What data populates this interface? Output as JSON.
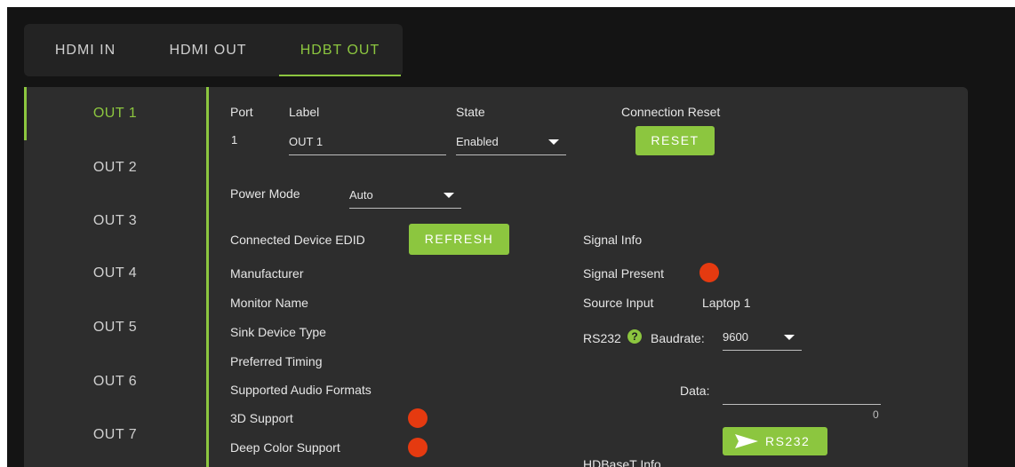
{
  "tabs": [
    {
      "label": "HDMI IN"
    },
    {
      "label": "HDMI OUT"
    },
    {
      "label": "HDBT OUT"
    }
  ],
  "active_tab": "HDBT OUT",
  "sidebar": {
    "items": [
      {
        "label": "OUT 1"
      },
      {
        "label": "OUT 2"
      },
      {
        "label": "OUT 3"
      },
      {
        "label": "OUT 4"
      },
      {
        "label": "OUT 5"
      },
      {
        "label": "OUT 6"
      },
      {
        "label": "OUT 7"
      }
    ],
    "selected": "OUT 1"
  },
  "port": {
    "header_port": "Port",
    "header_label": "Label",
    "header_state": "State",
    "header_reset": "Connection Reset",
    "number": "1",
    "label_value": "OUT 1",
    "state_value": "Enabled",
    "reset_label": "RESET"
  },
  "power": {
    "label": "Power Mode",
    "value": "Auto"
  },
  "edid": {
    "title": "Connected Device EDID",
    "refresh_label": "REFRESH",
    "manufacturer": "Manufacturer",
    "monitor_name": "Monitor Name",
    "sink_device_type": "Sink Device Type",
    "preferred_timing": "Preferred Timing",
    "supported_audio": "Supported Audio Formats",
    "support_3d": "3D Support",
    "deep_color": "Deep Color Support"
  },
  "signal": {
    "title": "Signal Info",
    "present_label": "Signal Present",
    "source_label": "Source Input",
    "source_value": "Laptop 1"
  },
  "rs232": {
    "label": "RS232",
    "help_glyph": "?",
    "baud_label": "Baudrate:",
    "baud_value": "9600",
    "data_label": "Data:",
    "data_value": "",
    "char_count": "0",
    "send_label": "RS232"
  },
  "hdbaset": {
    "title": "HDBaseT Info"
  },
  "colors": {
    "accent": "#8cc63f",
    "status_red": "#e53a10",
    "background": "#141414",
    "panel": "#2d2d2d"
  }
}
